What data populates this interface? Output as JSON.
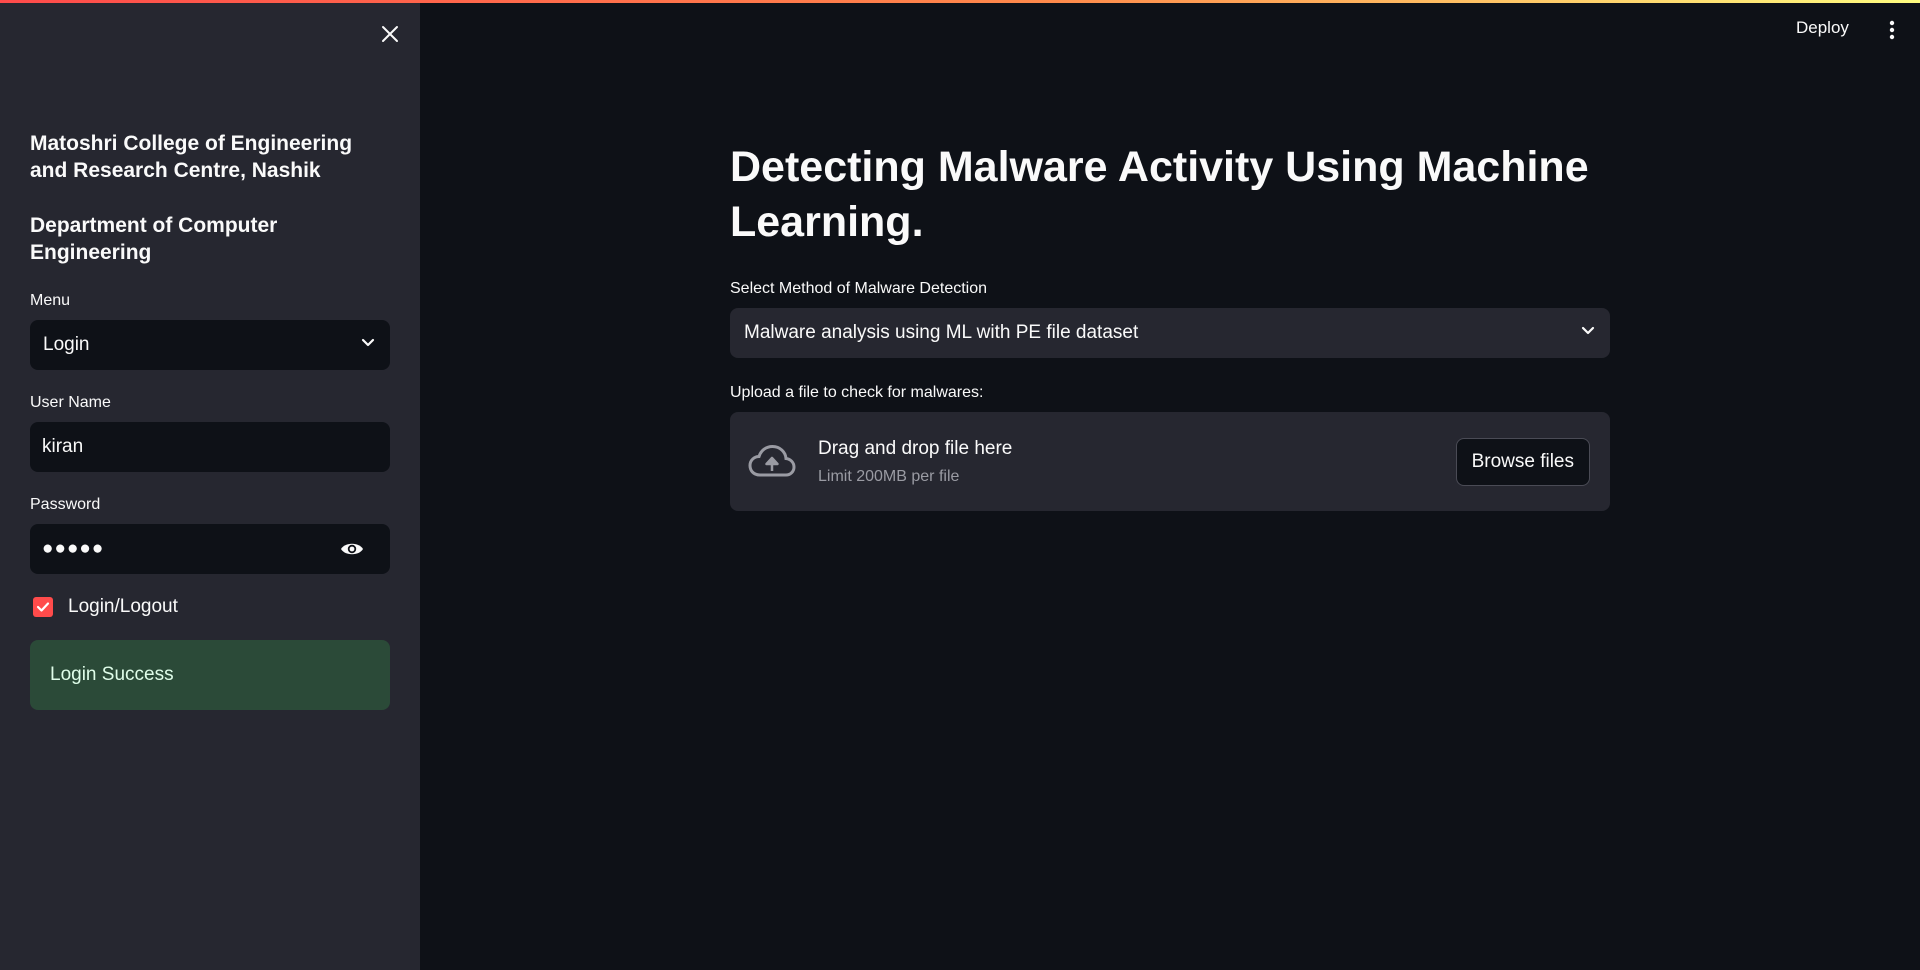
{
  "header": {
    "deploy_label": "Deploy",
    "menu_icon": "vertical-dots-icon"
  },
  "sidebar": {
    "close_icon": "close-icon",
    "college": "Matoshri College of Engineering and Research Centre, Nashik",
    "department": "Department of Computer Engineering",
    "menu": {
      "label": "Menu",
      "selected": "Login"
    },
    "username": {
      "label": "User Name",
      "value": "kiran"
    },
    "password": {
      "label": "Password",
      "value": "●●●●●"
    },
    "checkbox": {
      "label": "Login/Logout",
      "checked": true
    },
    "alert": "Login Success"
  },
  "main": {
    "title": "Detecting Malware Activity Using Machine Learning.",
    "method": {
      "label": "Select Method of Malware Detection",
      "selected": "Malware analysis using ML with PE file dataset"
    },
    "upload": {
      "label": "Upload a file to check for malwares:",
      "drop_text": "Drag and drop file here",
      "limit_text": "Limit 200MB per file",
      "browse_label": "Browse files"
    }
  },
  "colors": {
    "background": "#0e1117",
    "sidebar": "#262730",
    "accent": "#ff4b4b",
    "success_bg": "#2b4a38"
  }
}
